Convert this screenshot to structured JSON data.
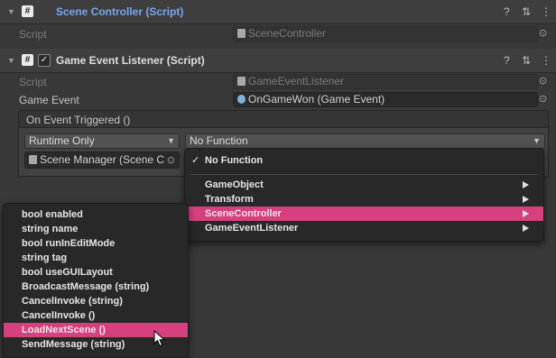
{
  "scene_controller": {
    "title": "Scene Controller (Script)",
    "title_color": "#79a6f0",
    "script_label": "Script",
    "script_value": "SceneController"
  },
  "listener": {
    "title": "Game Event Listener (Script)",
    "script_label": "Script",
    "script_value": "GameEventListener",
    "game_event_label": "Game Event",
    "game_event_value": "OnGameWon (Game Event)",
    "event_header": "On Event Triggered ()",
    "runtime_dropdown": "Runtime Only",
    "function_dropdown": "No Function",
    "object_field": "Scene Manager (Scene C"
  },
  "function_menu": {
    "check_mark": "✓",
    "none_item": "No Function",
    "items": [
      "GameObject",
      "Transform",
      "SceneController",
      "GameEventListener"
    ],
    "selected": "SceneController"
  },
  "method_menu": {
    "items": [
      "bool enabled",
      "string name",
      "bool runInEditMode",
      "string tag",
      "bool useGUILayout",
      "BroadcastMessage (string)",
      "CancelInvoke (string)",
      "CancelInvoke ()",
      "LoadNextScene ()",
      "SendMessage (string)"
    ],
    "selected": "LoadNextScene ()"
  },
  "icons": {
    "help": "?",
    "presets": "⇅",
    "more": "⋮",
    "script": "#",
    "fold": "▼",
    "picker": "⊙",
    "caret": "▼"
  },
  "colors": {
    "accent": "#d6407f"
  }
}
